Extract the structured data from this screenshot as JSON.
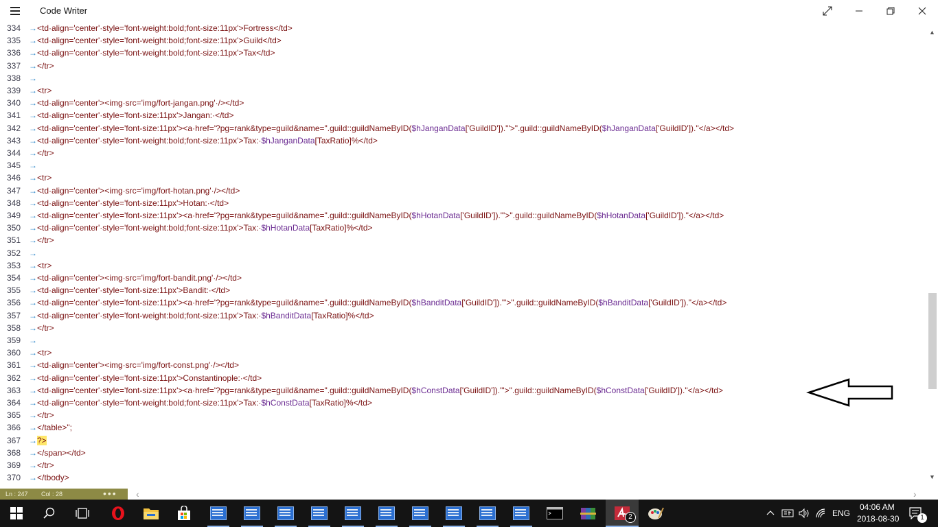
{
  "window": {
    "title": "Code Writer"
  },
  "gutter_tab": "→",
  "editor": {
    "lines": [
      {
        "n": "334",
        "c": [
          [
            "t",
            "<td·align='center'·style='font-weight:bold;font-size:11px'>Fortress</td>"
          ]
        ]
      },
      {
        "n": "335",
        "c": [
          [
            "t",
            "<td·align='center'·style='font-weight:bold;font-size:11px'>Guild</td>"
          ]
        ]
      },
      {
        "n": "336",
        "c": [
          [
            "t",
            "<td·align='center'·style='font-weight:bold;font-size:11px'>Tax</td>"
          ]
        ]
      },
      {
        "n": "337",
        "c": [
          [
            "t",
            "</tr>"
          ]
        ]
      },
      {
        "n": "338",
        "c": []
      },
      {
        "n": "339",
        "c": [
          [
            "t",
            "<tr>"
          ]
        ]
      },
      {
        "n": "340",
        "c": [
          [
            "t",
            "<td·align='center'><img·src='img/fort-jangan.png'·/></td>"
          ]
        ]
      },
      {
        "n": "341",
        "c": [
          [
            "t",
            "<td·align='center'·style='font-size:11px'>Jangan:·</td>"
          ]
        ]
      },
      {
        "n": "342",
        "c": [
          [
            "t",
            "<td·align='center'·style='font-size:11px'><a·href='?pg=rank&type=guild&name=\".guild::guildNameByID("
          ],
          [
            "v",
            "$hJanganData"
          ],
          [
            "t",
            "['GuildID']).\"'>\".guild::guildNameByID("
          ],
          [
            "v",
            "$hJanganData"
          ],
          [
            "t",
            "['GuildID']).\"</a></td>"
          ]
        ]
      },
      {
        "n": "343",
        "c": [
          [
            "t",
            "<td·align='center'·style='font-weight:bold;font-size:11px'>Tax:·"
          ],
          [
            "v",
            "$hJanganData"
          ],
          [
            "t",
            "[TaxRatio]%</td>"
          ]
        ]
      },
      {
        "n": "344",
        "c": [
          [
            "t",
            "</tr>"
          ]
        ]
      },
      {
        "n": "345",
        "c": []
      },
      {
        "n": "346",
        "c": [
          [
            "t",
            "<tr>"
          ]
        ]
      },
      {
        "n": "347",
        "c": [
          [
            "t",
            "<td·align='center'><img·src='img/fort-hotan.png'·/></td>"
          ]
        ]
      },
      {
        "n": "348",
        "c": [
          [
            "t",
            "<td·align='center'·style='font-size:11px'>Hotan:·</td>"
          ]
        ]
      },
      {
        "n": "349",
        "c": [
          [
            "t",
            "<td·align='center'·style='font-size:11px'><a·href='?pg=rank&type=guild&name=\".guild::guildNameByID("
          ],
          [
            "v",
            "$hHotanData"
          ],
          [
            "t",
            "['GuildID']).\"'>\".guild::guildNameByID("
          ],
          [
            "v",
            "$hHotanData"
          ],
          [
            "t",
            "['GuildID']).\"</a></td>"
          ]
        ]
      },
      {
        "n": "350",
        "c": [
          [
            "t",
            "<td·align='center'·style='font-weight:bold;font-size:11px'>Tax:·"
          ],
          [
            "v",
            "$hHotanData"
          ],
          [
            "t",
            "[TaxRatio]%</td>"
          ]
        ]
      },
      {
        "n": "351",
        "c": [
          [
            "t",
            "</tr>"
          ]
        ]
      },
      {
        "n": "352",
        "c": []
      },
      {
        "n": "353",
        "c": [
          [
            "t",
            "<tr>"
          ]
        ]
      },
      {
        "n": "354",
        "c": [
          [
            "t",
            "<td·align='center'><img·src='img/fort-bandit.png'·/></td>"
          ]
        ]
      },
      {
        "n": "355",
        "c": [
          [
            "t",
            "<td·align='center'·style='font-size:11px'>Bandit:·</td>"
          ]
        ]
      },
      {
        "n": "356",
        "c": [
          [
            "t",
            "<td·align='center'·style='font-size:11px'><a·href='?pg=rank&type=guild&name=\".guild::guildNameByID("
          ],
          [
            "v",
            "$hBanditData"
          ],
          [
            "t",
            "['GuildID']).\"'>\".guild::guildNameByID("
          ],
          [
            "v",
            "$hBanditData"
          ],
          [
            "t",
            "['GuildID']).\"</a></td>"
          ]
        ]
      },
      {
        "n": "357",
        "c": [
          [
            "t",
            "<td·align='center'·style='font-weight:bold;font-size:11px'>Tax:·"
          ],
          [
            "v",
            "$hBanditData"
          ],
          [
            "t",
            "[TaxRatio]%</td>"
          ]
        ]
      },
      {
        "n": "358",
        "c": [
          [
            "t",
            "</tr>"
          ]
        ]
      },
      {
        "n": "359",
        "c": []
      },
      {
        "n": "360",
        "c": [
          [
            "t",
            "<tr>"
          ]
        ]
      },
      {
        "n": "361",
        "c": [
          [
            "t",
            "<td·align='center'><img·src='img/fort-const.png'·/></td>"
          ]
        ]
      },
      {
        "n": "362",
        "c": [
          [
            "t",
            "<td·align='center'·style='font-size:11px'>Constantinople:·</td>"
          ]
        ]
      },
      {
        "n": "363",
        "c": [
          [
            "t",
            "<td·align='center'·style='font-size:11px'><a·href='?pg=rank&type=guild&name=\".guild::guildNameByID("
          ],
          [
            "v",
            "$hConstData"
          ],
          [
            "t",
            "['GuildID']).\"'>\".guild::guildNameByID("
          ],
          [
            "v",
            "$hConstData"
          ],
          [
            "t",
            "['GuildID']).\"</a></td>"
          ]
        ]
      },
      {
        "n": "364",
        "c": [
          [
            "t",
            "<td·align='center'·style='font-weight:bold;font-size:11px'>Tax:·"
          ],
          [
            "v",
            "$hConstData"
          ],
          [
            "t",
            "[TaxRatio]%</td>"
          ]
        ]
      },
      {
        "n": "365",
        "c": [
          [
            "t",
            "</tr>"
          ]
        ]
      },
      {
        "n": "366",
        "c": [
          [
            "t",
            "</table>\";"
          ]
        ]
      },
      {
        "n": "367",
        "c": [
          [
            "p",
            "?>"
          ]
        ]
      },
      {
        "n": "368",
        "c": [
          [
            "t",
            "</span></td>"
          ]
        ]
      },
      {
        "n": "369",
        "c": [
          [
            "t",
            "</tr>"
          ]
        ]
      },
      {
        "n": "370",
        "c": [
          [
            "t",
            "</tbody>"
          ]
        ]
      }
    ]
  },
  "status": {
    "ln": "Ln : 247",
    "col": "Col : 28"
  },
  "tray": {
    "lang": "ENG",
    "time": "04:06 AM",
    "date": "2018-08-30",
    "notifications": "1",
    "app_badge": "2"
  },
  "colors": {
    "status_bar": "#8d8a45",
    "variable": "#6a2a91",
    "code_text": "#7a1111",
    "tab_arrow": "#2a86c8",
    "taskbar": "#141414"
  }
}
